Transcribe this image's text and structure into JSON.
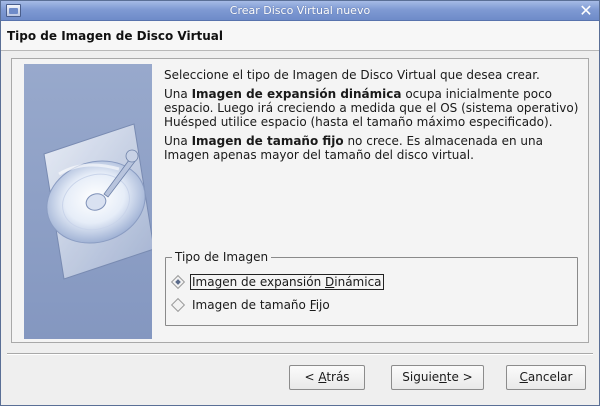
{
  "window": {
    "title": "Crear Disco Virtual nuevo",
    "close_symbol": "✕",
    "accent_color": "#7f9ad3"
  },
  "header": {
    "title": "Tipo de Imagen de Disco Virtual"
  },
  "content": {
    "para1": "Seleccione el tipo de Imagen de Disco Virtual que desea crear.",
    "para2": {
      "prefix": "Una ",
      "bold": "Imagen de expansión dinámica",
      "suffix": " ocupa inicialmente poco espacio. Luego irá creciendo a medida que el OS (sistema operativo) Huésped utilice espacio (hasta el tamaño máximo especificado)."
    },
    "para3": {
      "prefix": "Una ",
      "bold": "Imagen de tamaño fijo",
      "suffix": " no crece. Es almacenada en una Imagen apenas mayor del tamaño del disco virtual."
    }
  },
  "image_type_group": {
    "legend": "Tipo de Imagen",
    "options": [
      {
        "label_pre": "Imagen de expansión ",
        "label_mnemonic": "D",
        "label_post": "inámica",
        "selected": true
      },
      {
        "label_pre": "Imagen de tamaño ",
        "label_mnemonic": "F",
        "label_post": "ijo",
        "selected": false
      }
    ]
  },
  "buttons": {
    "back": {
      "pre": "< ",
      "mnemonic": "A",
      "post": "trás"
    },
    "next": {
      "pre": "Siguie",
      "mnemonic": "n",
      "post": "te >"
    },
    "cancel": {
      "pre": "",
      "mnemonic": "C",
      "post": "ancelar"
    }
  },
  "icons": {
    "window_icon": "virtualbox-window-icon",
    "side_image": "hard-disk-illustration"
  }
}
